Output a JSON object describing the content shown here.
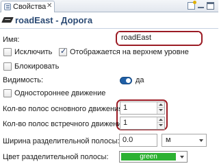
{
  "tab": {
    "label": "Свойства",
    "close": "✕"
  },
  "header": {
    "title": "roadEast - Дорога"
  },
  "form": {
    "name_label": "Имя:",
    "name_value": "roadEast",
    "exclude_label": "Исключить",
    "exclude_checked": false,
    "top_level_label": "Отображается на верхнем уровне",
    "top_level_checked": true,
    "lock_label": "Блокировать",
    "lock_checked": false,
    "visibility_label": "Видимость:",
    "visibility_value": "да",
    "one_way_label": "Одностороннее движение",
    "one_way_checked": false,
    "forward_lanes_label": "Кол-во полос основного движения:",
    "forward_lanes_value": "1",
    "backward_lanes_label": "Кол-во полос встречного движения:",
    "backward_lanes_value": "1",
    "median_width_label": "Ширина разделительной полосы:",
    "median_width_value": "0.0",
    "median_width_unit": "м",
    "median_color_label": "Цвет разделительной полосы:",
    "median_color_value": "green",
    "median_color_hex": "#2db132"
  },
  "icons": [
    "properties-tab-icon",
    "road-icon",
    "new-view-icon",
    "minimize-icon",
    "maximize-icon"
  ],
  "colors": {
    "highlight": "#9b1b24",
    "title": "#2b4a74",
    "toggle": "#1f5fa6"
  }
}
